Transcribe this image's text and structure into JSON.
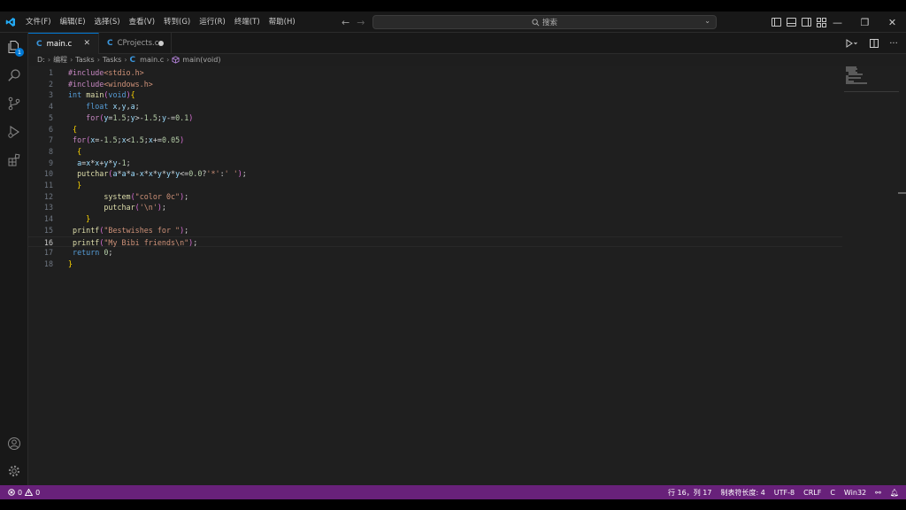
{
  "menu": [
    "文件(F)",
    "编辑(E)",
    "选择(S)",
    "查看(V)",
    "转到(G)",
    "运行(R)",
    "终端(T)",
    "帮助(H)"
  ],
  "search": {
    "label": "搜索"
  },
  "tabs": [
    {
      "label": "main.c",
      "active": true
    },
    {
      "label": "CProjects.c",
      "active": false,
      "modified": true
    }
  ],
  "breadcrumb": [
    "D:",
    "编程",
    "Tasks",
    "Tasks",
    "main.c",
    "main(void)"
  ],
  "activity_badge": "1",
  "editor": {
    "current_line": 16,
    "lines": [
      {
        "n": "1",
        "text": "#include<stdio.h>"
      },
      {
        "n": "2",
        "text": "#include<windows.h>"
      },
      {
        "n": "3",
        "text": "int main(void){"
      },
      {
        "n": "4",
        "text": "    float x,y,a;"
      },
      {
        "n": "5",
        "text": "    for(y=1.5;y>-1.5;y-=0.1)"
      },
      {
        "n": "6",
        "text": " {"
      },
      {
        "n": "7",
        "text": " for(x=-1.5;x<1.5;x+=0.05)"
      },
      {
        "n": "8",
        "text": "  {"
      },
      {
        "n": "9",
        "text": "  a=x*x+y*y-1;"
      },
      {
        "n": "10",
        "text": "  putchar(a*a*a-x*x*y*y*y<=0.0?'*':' ');"
      },
      {
        "n": "11",
        "text": "  }"
      },
      {
        "n": "12",
        "text": "        system(\"color 0c\");"
      },
      {
        "n": "13",
        "text": "        putchar('\\n');"
      },
      {
        "n": "14",
        "text": "    }"
      },
      {
        "n": "15",
        "text": " printf(\"Bestwishes for \");"
      },
      {
        "n": "16",
        "text": " printf(\"My Bibi friends\\n\");"
      },
      {
        "n": "17",
        "text": " return 0;"
      },
      {
        "n": "18",
        "text": "}"
      }
    ]
  },
  "statusbar": {
    "errors": "0",
    "warnings": "0",
    "position": "行 16，列 17",
    "indent": "制表符长度: 4",
    "encoding": "UTF-8",
    "eol": "CRLF",
    "language": "C",
    "platform": "Win32"
  },
  "colors": {
    "accent": "#0078d4",
    "statusbar": "#68217a",
    "editor_bg": "#1f1f1f"
  }
}
